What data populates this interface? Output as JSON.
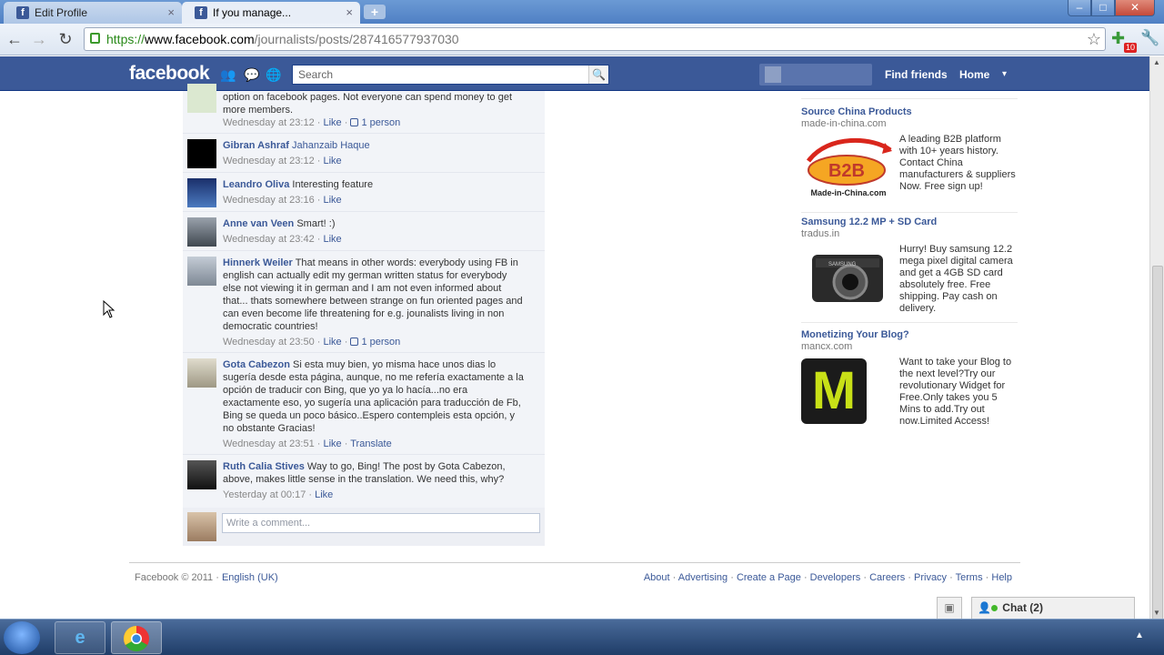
{
  "browser": {
    "tabs": [
      {
        "label": "Edit Profile",
        "close": "×"
      },
      {
        "label": "If you manage...",
        "close": "×"
      }
    ],
    "new_tab": "+",
    "window_buttons": {
      "min": "‒",
      "max": "□",
      "close": "✕"
    },
    "url": {
      "scheme": "https://",
      "host": "www.facebook.com",
      "path": "/journalists/posts/287416577937030"
    },
    "extension_badge": "10"
  },
  "fb_header": {
    "logo": "facebook",
    "search_placeholder": "Search",
    "find_friends": "Find friends",
    "home": "Home",
    "caret": "▾"
  },
  "comments": [
    {
      "name": "",
      "text": "option on facebook pages. Not everyone can spend money to get more members.",
      "time": "Wednesday at 23:12",
      "like": "Like",
      "likes_count": "1 person",
      "avatar_color": "#dbe8d0"
    },
    {
      "name": "Gibran Ashraf",
      "text": "",
      "tag": "Jahanzaib Haque",
      "time": "Wednesday at 23:12",
      "like": "Like",
      "likes_count": "",
      "avatar_color": "#000000"
    },
    {
      "name": "Leandro Oliva",
      "text": "Interesting feature",
      "time": "Wednesday at 23:16",
      "like": "Like",
      "likes_count": "",
      "avatar_color": "#2b4a8a"
    },
    {
      "name": "Anne van Veen",
      "text": "Smart! :)",
      "time": "Wednesday at 23:42",
      "like": "Like",
      "likes_count": "",
      "avatar_color": "#6a7480"
    },
    {
      "name": "Hinnerk Weiler",
      "text": "That means in other words: everybody using FB in english can actually edit my german written status for everybody else not viewing it in german and I am not even informed about that... thats somewhere between strange on fun oriented pages and can even become life threatening for e.g. jounalists living in non democratic countries!",
      "time": "Wednesday at 23:50",
      "like": "Like",
      "likes_count": "1 person",
      "avatar_color": "#9aa4ae"
    },
    {
      "name": "Gota Cabezon",
      "text": "Si esta muy bien, yo misma hace unos dias lo sugería desde esta página, aunque, no me refería exactamente a la opción de traducir con Bing, que yo ya lo hacía...no era exactamente eso, yo sugería una aplicación para traducción de Fb, Bing se queda un poco básico..Espero contempleis esta opción, y no obstante Gracias!",
      "time": "Wednesday at 23:51",
      "like": "Like",
      "translate": "Translate",
      "likes_count": "",
      "avatar_color": "#c8c2b0"
    },
    {
      "name": "Ruth Calia Stives",
      "text": "Way to go, Bing! The post by Gota Cabezon, above, makes little sense in the translation. We need this, why?",
      "time": "Yesterday at 00:17",
      "like": "Like",
      "likes_count": "",
      "avatar_color": "#2a2a2a"
    }
  ],
  "write_comment_placeholder": "Write a comment...",
  "ads": [
    {
      "title": "Source China Products",
      "source": "made-in-china.com",
      "desc": "A leading B2B platform with 10+ years history. Contact China manufacturers & suppliers Now. Free sign up!",
      "img_label": "B2B",
      "img_sub": "Made-in-China.com"
    },
    {
      "title": "Samsung 12.2 MP + SD Card",
      "source": "tradus.in",
      "desc": "Hurry! Buy samsung 12.2 mega pixel digital camera and get a 4GB SD card absolutely free. Free shipping. Pay cash on delivery.",
      "img_label": "SAMSUNG"
    },
    {
      "title": "Monetizing Your Blog?",
      "source": "mancx.com",
      "desc": "Want to take your Blog to the next level?Try our revolutionary Widget for Free.Only takes you 5 Mins to add.Try out now.Limited Access!",
      "img_label": "M"
    }
  ],
  "footer": {
    "copyright": "Facebook © 2011",
    "language": "English (UK)",
    "links": [
      "About",
      "Advertising",
      "Create a Page",
      "Developers",
      "Careers",
      "Privacy",
      "Terms",
      "Help"
    ],
    "separator": " · "
  },
  "chat": {
    "label": "Chat (2)"
  },
  "colors": {
    "fb_blue": "#3b5998",
    "link": "#3b5998",
    "meta": "#888888"
  }
}
